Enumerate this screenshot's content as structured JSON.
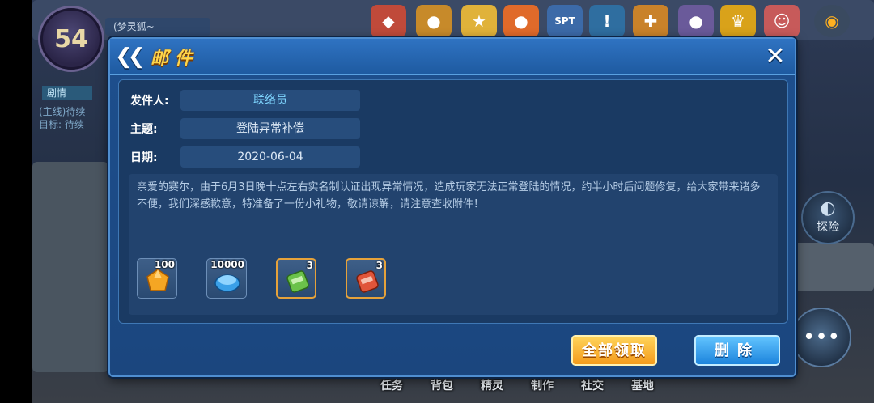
{
  "hud": {
    "level": "54",
    "player_name": "(梦灵狐~",
    "quest_tab": "剧情",
    "quest_line1": "(主线)待续",
    "quest_line2": "目标: 待续",
    "explore_label": "探险",
    "bottom_nav": [
      "任务",
      "背包",
      "精灵",
      "制作",
      "社交",
      "基地"
    ]
  },
  "mail": {
    "title": "邮件",
    "fields": {
      "sender_label": "发件人:",
      "sender_value": "联络员",
      "subject_label": "主题:",
      "subject_value": "登陆异常补偿",
      "date_label": "日期:",
      "date_value": "2020-06-04"
    },
    "message": "亲爱的赛尔，由于6月3日晚十点左右实名制认证出现异常情况，造成玩家无法正常登陆的情况，约半小时后问题修复，给大家带来诸多不便，我们深感歉意，特准备了一份小礼物，敬请谅解，请注意查收附件！",
    "attachments": [
      {
        "qty": "100",
        "icon": "orange-crystal-icon"
      },
      {
        "qty": "10000",
        "icon": "blue-bean-coin-icon"
      },
      {
        "qty": "3",
        "icon": "green-capsule-icon"
      },
      {
        "qty": "3",
        "icon": "red-capsule-icon"
      }
    ],
    "buttons": {
      "claim_all": "全部领取",
      "delete": "删除"
    }
  }
}
